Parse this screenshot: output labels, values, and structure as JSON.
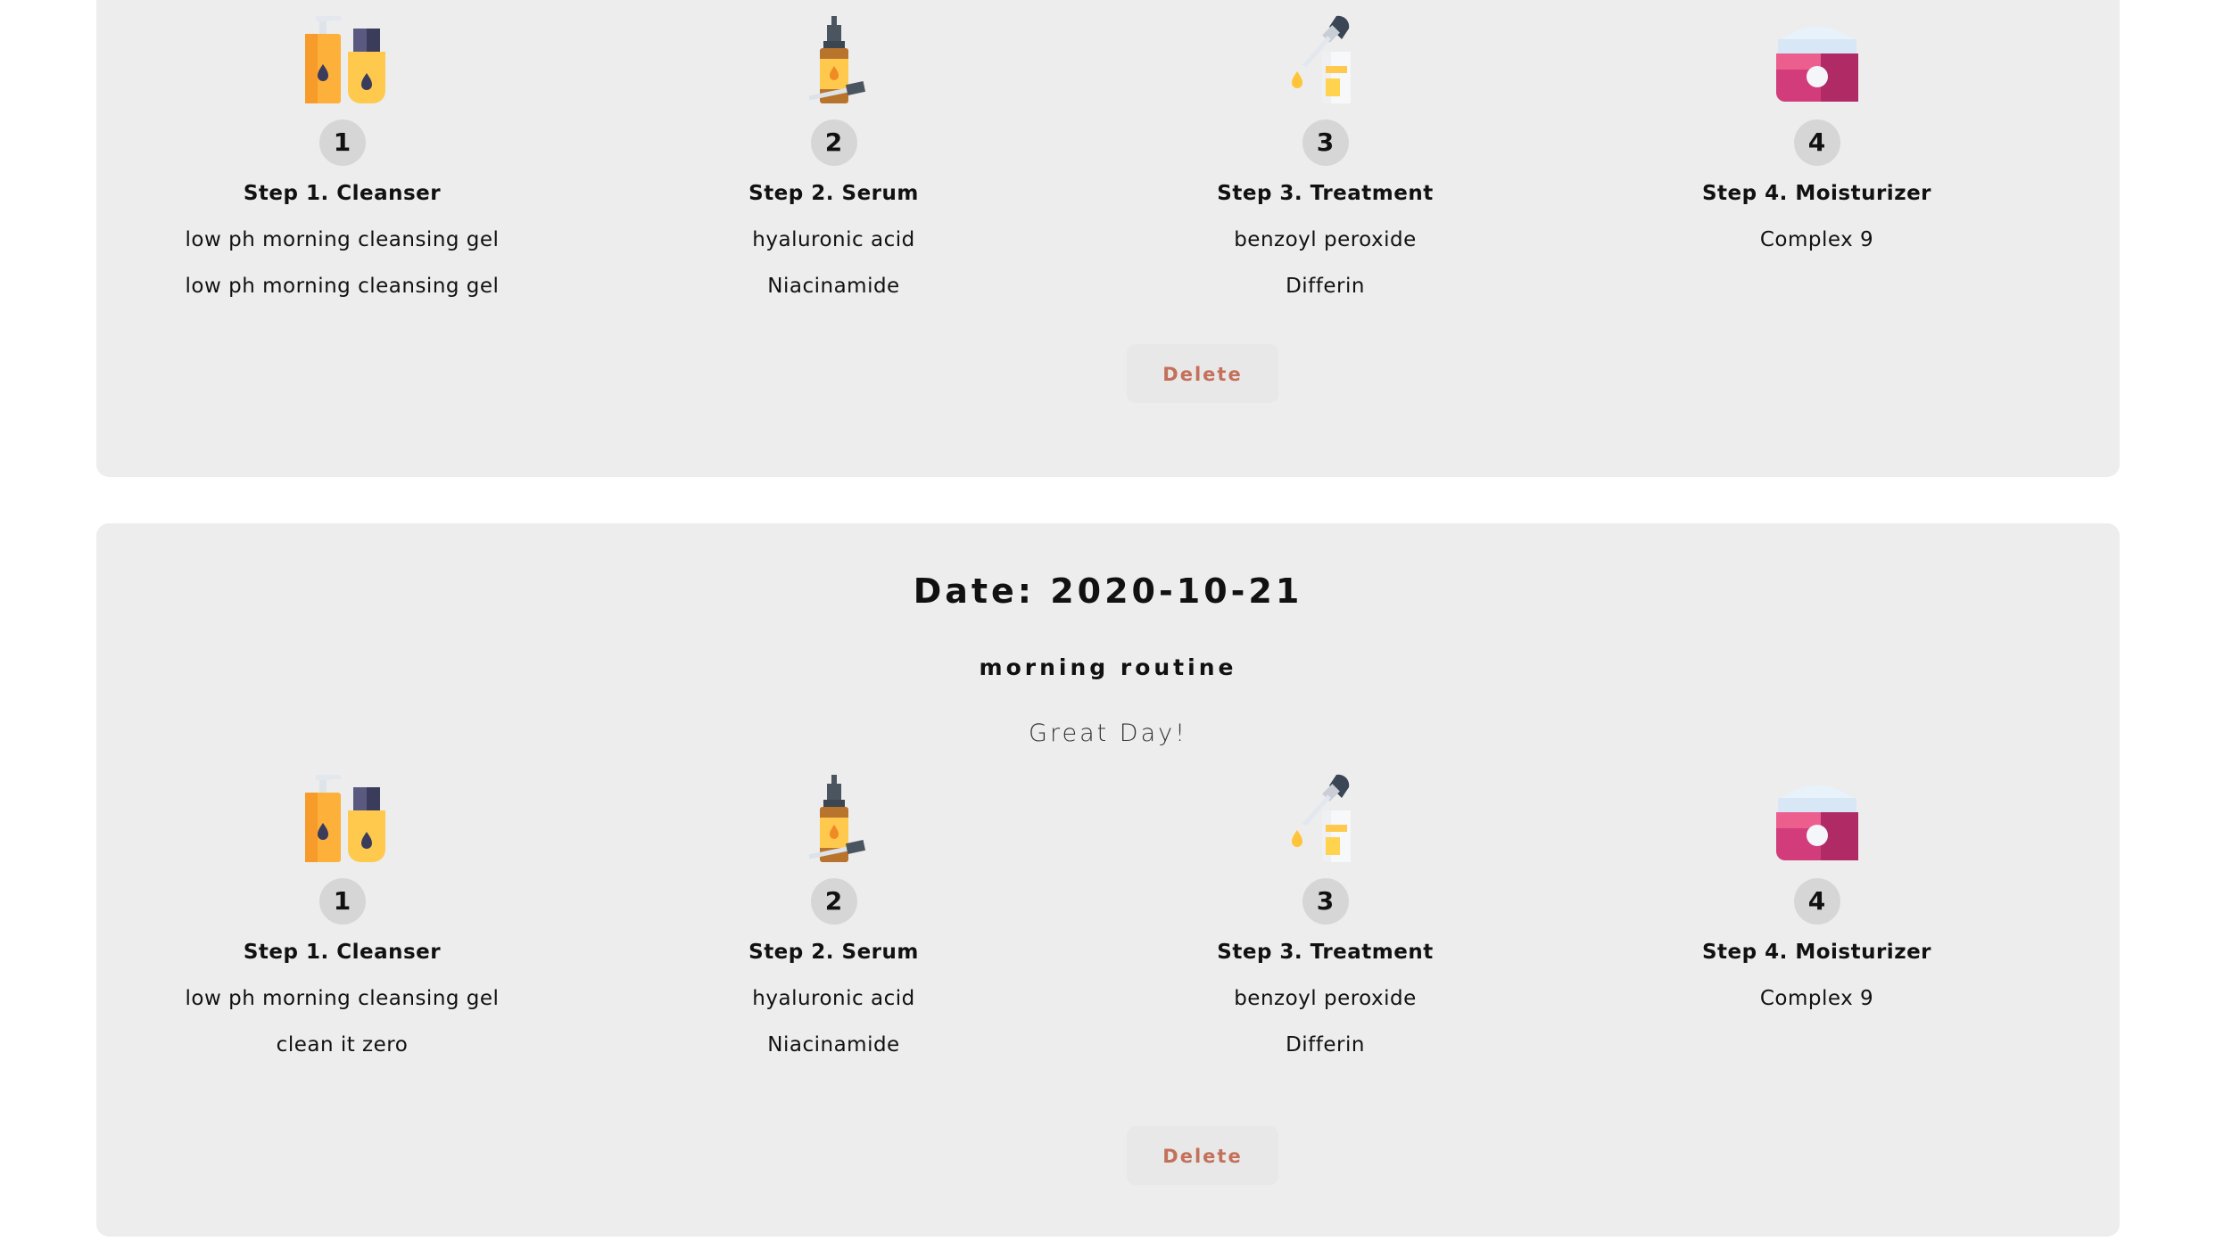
{
  "entries": [
    {
      "steps": [
        {
          "num": "1",
          "name": "Step 1. Cleanser",
          "products": [
            "low ph morning cleansing gel",
            "low ph morning cleansing gel"
          ],
          "icon": "cleanser-bottles-icon"
        },
        {
          "num": "2",
          "name": "Step 2. Serum",
          "products": [
            "hyaluronic acid",
            "Niacinamide"
          ],
          "icon": "serum-dropper-bottle-icon"
        },
        {
          "num": "3",
          "name": "Step 3. Treatment",
          "products": [
            "benzoyl peroxide",
            "Differin"
          ],
          "icon": "treatment-dropper-icon"
        },
        {
          "num": "4",
          "name": "Step 4. Moisturizer",
          "products": [
            "Complex 9",
            ""
          ],
          "icon": "moisturizer-jar-icon"
        }
      ],
      "delete_label": "Delete"
    },
    {
      "date_title": "Date: 2020-10-21",
      "routine": "morning routine",
      "note": "Great Day!",
      "steps": [
        {
          "num": "1",
          "name": "Step 1. Cleanser",
          "products": [
            "low ph morning cleansing gel",
            "clean it zero"
          ],
          "icon": "cleanser-bottles-icon"
        },
        {
          "num": "2",
          "name": "Step 2. Serum",
          "products": [
            "hyaluronic acid",
            "Niacinamide"
          ],
          "icon": "serum-dropper-bottle-icon"
        },
        {
          "num": "3",
          "name": "Step 3. Treatment",
          "products": [
            "benzoyl peroxide",
            "Differin"
          ],
          "icon": "treatment-dropper-icon"
        },
        {
          "num": "4",
          "name": "Step 4. Moisturizer",
          "products": [
            "Complex 9",
            ""
          ],
          "icon": "moisturizer-jar-icon"
        }
      ],
      "delete_label": "Delete"
    }
  ],
  "colors": {
    "card_bg": "#ededed",
    "delete_text": "#c4705a",
    "step_badge": "#d6d6d6"
  }
}
